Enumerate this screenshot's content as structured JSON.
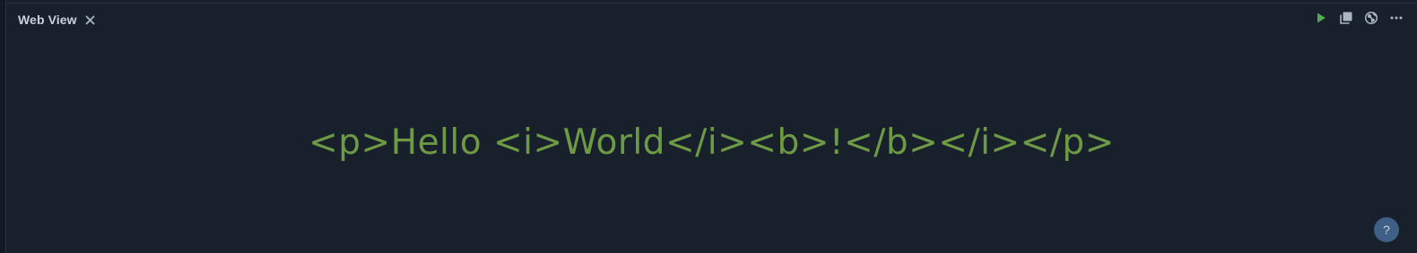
{
  "panel": {
    "tab_title": "Web View",
    "close_glyph": "✕",
    "close_icon": "close-icon"
  },
  "toolbar": {
    "icons": [
      "play-icon",
      "copy-icon",
      "globe-icon",
      "more-icon"
    ],
    "play_color": "#4caf50",
    "icon_color": "#aab6c3"
  },
  "content": {
    "rendered_text": "<p>Hello <i>World</i><b>!</b></i></p>",
    "text_color": "#6e9a45"
  },
  "help": {
    "label": "?",
    "color": "#3f5f86"
  }
}
